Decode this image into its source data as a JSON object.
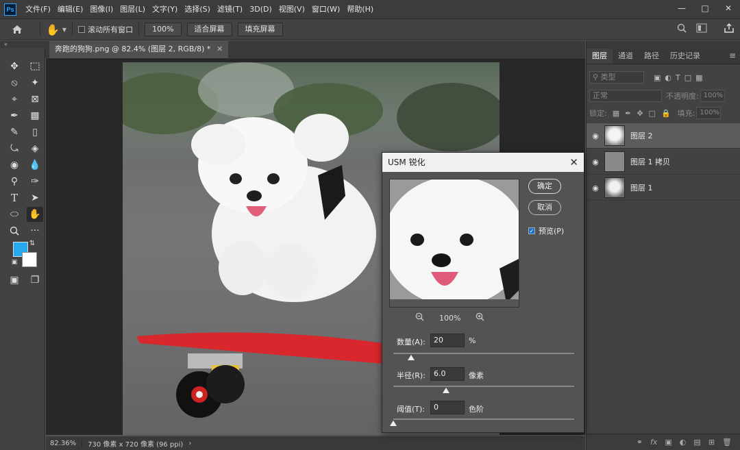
{
  "app": {
    "logo": "Ps",
    "menu": [
      "文件(F)",
      "编辑(E)",
      "图像(I)",
      "图层(L)",
      "文字(Y)",
      "选择(S)",
      "滤镜(T)",
      "3D(D)",
      "视图(V)",
      "窗口(W)",
      "帮助(H)"
    ]
  },
  "options_bar": {
    "scroll_all_label": "滚动所有窗口",
    "zoom_value": "100%",
    "fit_screen_label": "适合屏幕",
    "fill_screen_label": "填充屏幕"
  },
  "document": {
    "tab_title": "奔跑的狗狗.png @ 82.4% (图层 2, RGB/8) *",
    "status_zoom": "82.36%",
    "status_info": "730 像素 x 720 像素 (96 ppi)"
  },
  "colors": {
    "foreground": "#29a9f0",
    "background": "#ffffff",
    "accent": "#31a8ff"
  },
  "layers_panel": {
    "tabs": [
      "图层",
      "通道",
      "路径",
      "历史记录"
    ],
    "filter_placeholder": "类型",
    "blend_mode": "正常",
    "opacity_label": "不透明度:",
    "opacity_value": "100%",
    "lock_label": "锁定:",
    "fill_label": "填充:",
    "fill_value": "100%",
    "layers": [
      {
        "name": "图层 2",
        "selected": true,
        "visible": true
      },
      {
        "name": "图层 1 拷贝",
        "selected": false,
        "visible": true
      },
      {
        "name": "图层 1",
        "selected": false,
        "visible": true
      }
    ]
  },
  "usm_dialog": {
    "title": "USM 锐化",
    "ok_label": "确定",
    "cancel_label": "取消",
    "preview_label": "预览(P)",
    "preview_checked": true,
    "preview_zoom": "100%",
    "amount": {
      "label": "数量(A):",
      "value": "20",
      "unit": "%",
      "slider_fraction": 0.1
    },
    "radius": {
      "label": "半径(R):",
      "value": "6.0",
      "unit": "像素",
      "slider_fraction": 0.29
    },
    "threshold": {
      "label": "阈值(T):",
      "value": "0",
      "unit": "色阶",
      "slider_fraction": 0.0
    }
  }
}
